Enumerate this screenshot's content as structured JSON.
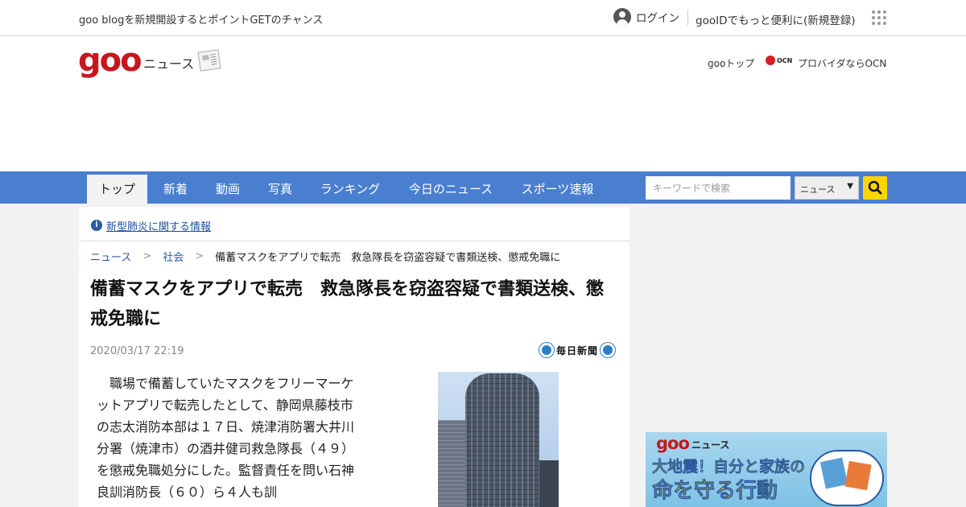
{
  "topbar": {
    "promo": "goo blogを新規開設するとポイントGETのチャンス",
    "login": "ログイン",
    "register": "gooIDでもっと便利に(新規登録)"
  },
  "header": {
    "logo": "goo",
    "section": "ニュース",
    "gootop": "gooトップ",
    "ocn_logo": "OCN",
    "ocn_label": "プロバイダならOCN"
  },
  "nav": {
    "tabs": [
      {
        "label": "トップ",
        "active": true
      },
      {
        "label": "新着"
      },
      {
        "label": "動画"
      },
      {
        "label": "写真"
      },
      {
        "label": "ランキング"
      },
      {
        "label": "今日のニュース"
      },
      {
        "label": "スポーツ速報"
      }
    ],
    "search_placeholder": "キーワードで検索",
    "select_value": "ニュース",
    "search_icon": "search-icon"
  },
  "notice": {
    "link": "新型肺炎に関する情報"
  },
  "breadcrumb": {
    "items": [
      "ニュース",
      "社会"
    ],
    "separator": ">",
    "current": "備蓄マスクをアプリで転売　救急隊長を窃盗容疑で書類送検、懲戒免職に"
  },
  "article": {
    "title": "備蓄マスクをアプリで転売　救急隊長を窃盗容疑で書類送検、懲戒免職に",
    "date": "2020/03/17 22:19",
    "source": "毎日新聞",
    "body": "職場で備蓄していたマスクをフリーマーケットアプリで転売したとして、静岡県藤枝市の志太消防本部は１７日、焼津消防署大井川分署（焼津市）の酒井健司救急隊長（４９）を懲戒免職処分にした。監督責任を問い石神良訓消防長（６０）ら４人も訓"
  },
  "ad": {
    "goo": "goo",
    "news": "ニュース",
    "line1": "大地震！自分と家族の",
    "line2": "命を守る行動"
  },
  "colors": {
    "nav_blue": "#4a7fd0",
    "logo_red": "#c8161d",
    "search_button": "#ffd400",
    "link_blue": "#2a5aa0"
  }
}
